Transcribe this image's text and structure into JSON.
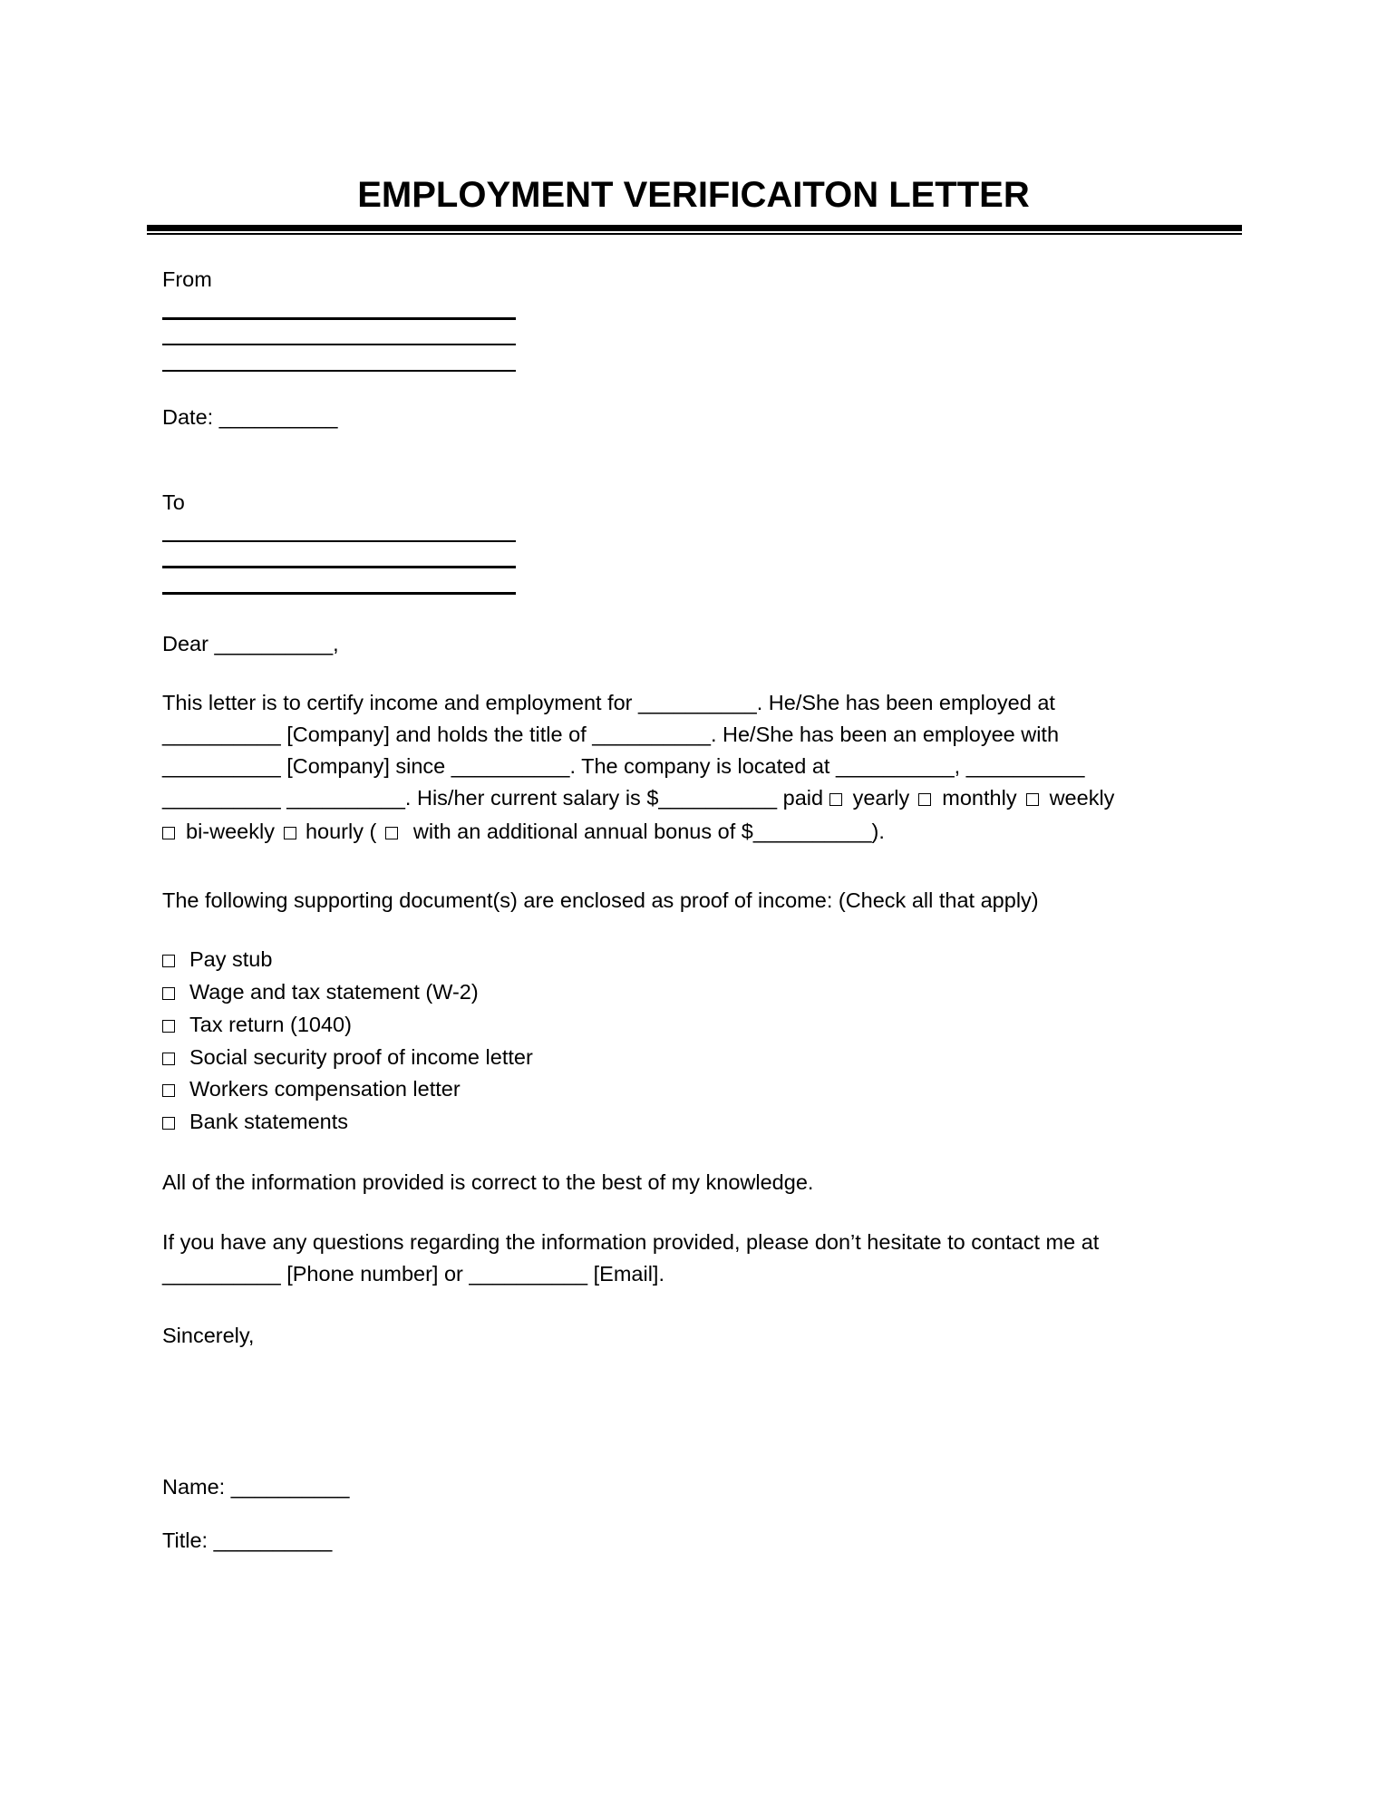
{
  "title": "EMPLOYMENT VERIFICAITON LETTER",
  "from_label": "From",
  "date_label": "Date: __________",
  "to_label": "To",
  "dear": "Dear __________,",
  "body_lines": [
    "This letter is to certify income and employment for __________. He/She has been employed at",
    "__________ [Company] and holds the title of __________. He/She has been an employee with",
    "__________ [Company] since __________. The company is located at __________, __________",
    "__________ __________. His/her current salary is $__________ paid ",
    ""
  ],
  "pay_options": {
    "line4": [
      {
        "label": "yearly",
        "checked": false
      },
      {
        "label": "monthly",
        "checked": false
      },
      {
        "label": "weekly",
        "checked": false
      }
    ],
    "line5": [
      {
        "label": "bi-weekly",
        "checked": false
      },
      {
        "label": "hourly (",
        "checked": false
      },
      {
        "label": " with an additional annual bonus of $__________).",
        "checked": false
      }
    ]
  },
  "docs_intro": "The following supporting document(s) are enclosed as proof of income: (Check all that apply)",
  "documents": [
    {
      "label": "Pay stub",
      "checked": false
    },
    {
      "label": "Wage and tax statement (W-2)",
      "checked": false
    },
    {
      "label": "Tax return (1040)",
      "checked": false
    },
    {
      "label": "Social security proof of income letter",
      "checked": false
    },
    {
      "label": "Workers compensation letter",
      "checked": false
    },
    {
      "label": "Bank statements",
      "checked": false
    }
  ],
  "attestation": "All of the information provided is correct to the best of my knowledge.",
  "contact_lines": [
    "If you have any questions regarding the information provided, please don’t hesitate to contact me at",
    "__________ [Phone number] or __________ [Email]."
  ],
  "closing": "Sincerely,",
  "name_label": "Name: __________",
  "title_label": "Title: __________"
}
